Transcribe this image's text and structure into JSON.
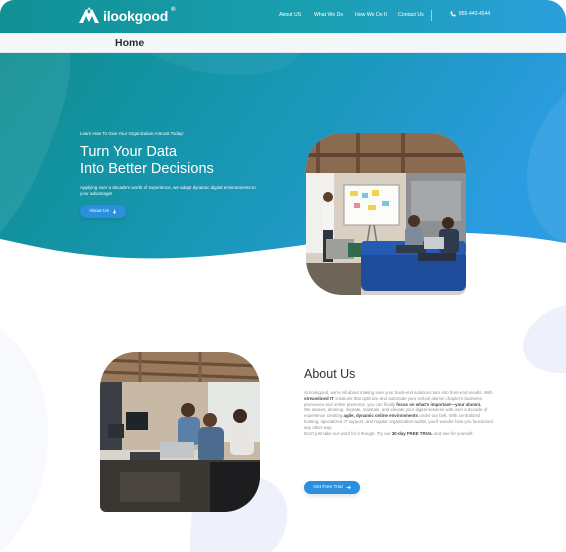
{
  "nav": {
    "brand": "ilookgood",
    "brand_mark": "®",
    "links": [
      "About US",
      "What We Do",
      "How We Do It",
      "Contact Us"
    ],
    "phone": "855-440-4544"
  },
  "page": {
    "title": "Home"
  },
  "hero": {
    "kicker": "Learn How To Give Your Organization A Boost Today!",
    "heading_line1": "Turn Your Data",
    "heading_line2": "Into Better Decisions",
    "subtext": "Applying over a decade's worth of experience, we adapt dynamic digital environments to your advantage!",
    "button_label": "About Us",
    "button_icon": "arrow-down-icon"
  },
  "about": {
    "heading": "About Us",
    "p1_a": "At ilookgood, we're all about making sure your back-end solutions turn into front-end results. With ",
    "p1_b": "streamlined IT",
    "p1_c": " solutions that optimize and automate your school alumni chapter's business processes and online presence, you can finally ",
    "p1_d": "focus on what's important—your alumni.",
    "p2_a": "We assess, develop, migrate, maintain, and elevate your digital services with over a decade of experience creating ",
    "p2_b": "agile, dynamic online environments",
    "p2_c": " under our belt. With centralized hosting, specialized IT support, and regular organization audits, you'll wonder how you functioned any other way.",
    "p3_a": "Don't just take our word for it though. Try our ",
    "p3_b": "30-day FREE TRIAL",
    "p3_c": " and see for yourself.",
    "button_label": "Get Free Trial",
    "button_icon": "arrow-right-icon"
  },
  "colors": {
    "teal": "#119196",
    "blue": "#2c8fde",
    "light_blob": "#eef1fb"
  }
}
